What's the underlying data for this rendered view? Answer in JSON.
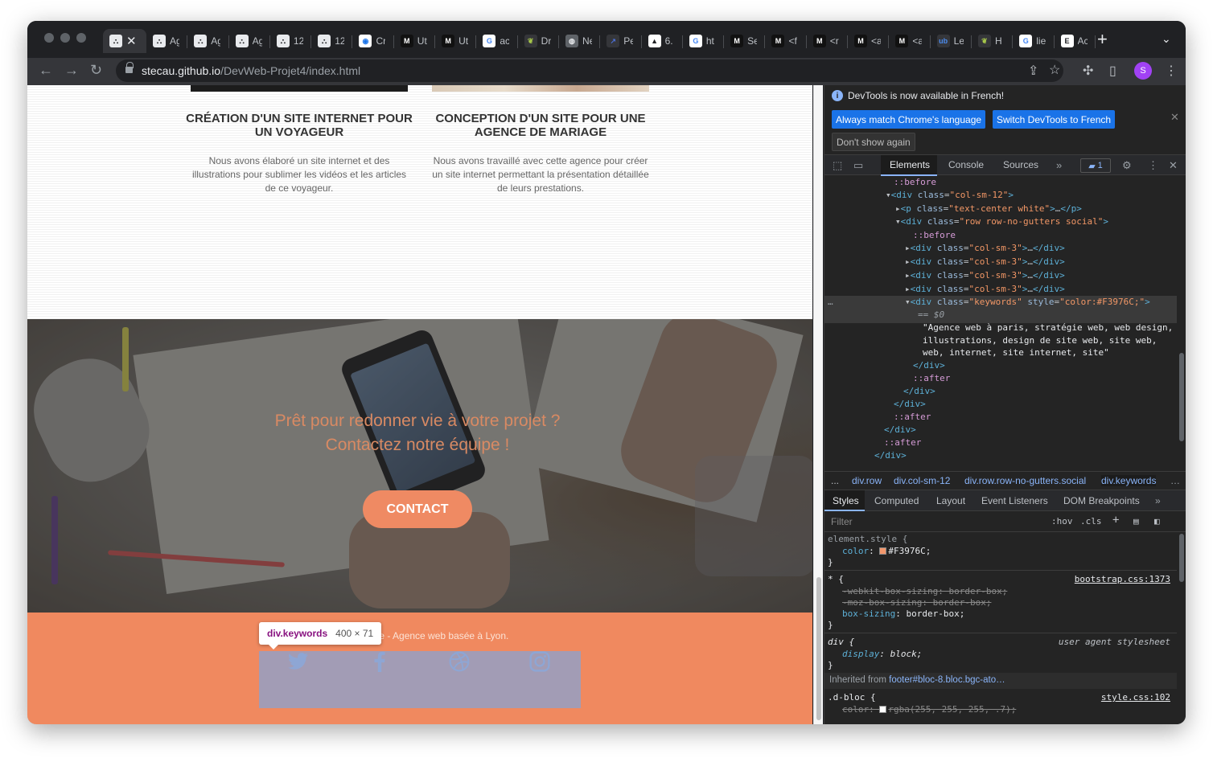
{
  "browser": {
    "tabs": [
      {
        "label": "Ag",
        "fav": "cat",
        "active": true
      },
      {
        "label": "Ag",
        "fav": "cat"
      },
      {
        "label": "Ag",
        "fav": "cat"
      },
      {
        "label": "Ag",
        "fav": "cat"
      },
      {
        "label": "12",
        "fav": "cat"
      },
      {
        "label": "12",
        "fav": "cat"
      },
      {
        "label": "Cr",
        "fav": "chrome"
      },
      {
        "label": "Ut",
        "fav": "m"
      },
      {
        "label": "Ut",
        "fav": "m"
      },
      {
        "label": "ac",
        "fav": "google"
      },
      {
        "label": "Dr",
        "fav": "leaf"
      },
      {
        "label": "Ne",
        "fav": "globe"
      },
      {
        "label": "Pe",
        "fav": "arrow"
      },
      {
        "label": "6.",
        "fav": "peak"
      },
      {
        "label": "ht",
        "fav": "google"
      },
      {
        "label": "Se",
        "fav": "m"
      },
      {
        "label": "<f",
        "fav": "m"
      },
      {
        "label": "<r",
        "fav": "m"
      },
      {
        "label": "<a",
        "fav": "m"
      },
      {
        "label": "<a",
        "fav": "m"
      },
      {
        "label": "Le",
        "fav": "ub"
      },
      {
        "label": "H",
        "fav": "leaf"
      },
      {
        "label": "lie",
        "fav": "google"
      },
      {
        "label": "Ac",
        "fav": "e"
      }
    ],
    "url_domain": "stecau.github.io",
    "url_path": "/DevWeb-Projet4/index.html",
    "profile_initial": "S"
  },
  "page": {
    "projects": [
      {
        "title": "CRÉATION D'UN SITE INTERNET POUR UN VOYAGEUR",
        "desc": "Nous avons élaboré un site internet et des illustrations pour sublimer les vidéos et les articles de ce voyageur."
      },
      {
        "title": "CONCEPTION D'UN SITE POUR UNE AGENCE DE MARIAGE",
        "desc": "Nous avons travaillé avec cette agence pour créer un site internet permettant la présentation détaillée de leurs prestations."
      }
    ],
    "cta_line1": "Prêt pour redonner vie à votre projet ?",
    "cta_line2": "Contactez notre équipe !",
    "contact_button": "CONTACT",
    "footer_text": "here - Agence web basée à Lyon.",
    "tooltip_name": "div.keywords",
    "tooltip_size": "400 × 71",
    "social_icons": [
      "twitter-icon",
      "facebook-icon",
      "dribbble-icon",
      "instagram-icon"
    ],
    "colors": {
      "accent": "#F3976C",
      "footer": "#f0895f"
    }
  },
  "devtools": {
    "info_text": "DevTools is now available in French!",
    "btn_match": "Always match Chrome's language",
    "btn_switch": "Switch DevTools to French",
    "btn_dont_show": "Don't show again",
    "tabs": [
      "Elements",
      "Console",
      "Sources"
    ],
    "issues_count": "1",
    "dom": {
      "before1": "::before",
      "div_col": "div",
      "div_col_class": "col-sm-12",
      "p_class": "text-center white",
      "div_row_class": "row row-no-gutters social",
      "before2": "::before",
      "col3": "col-sm-3",
      "ellipsis": "…",
      "kw_class": "keywords",
      "kw_style": "color:#F3976C;",
      "eq": "== $0",
      "kw_text_1": "\"Agence web à paris, stratégie web, web design,",
      "kw_text_2": "illustrations, design de site web, site web,",
      "kw_text_3": "web, internet, site internet, site\"",
      "after": "::after"
    },
    "crumbs": [
      "...",
      "div.row",
      "div.col-sm-12",
      "div.row.row-no-gutters.social",
      "div.keywords"
    ],
    "style_tabs": [
      "Styles",
      "Computed",
      "Layout",
      "Event Listeners",
      "DOM Breakpoints"
    ],
    "filter_placeholder": "Filter",
    "hov": ":hov",
    "cls": ".cls",
    "rules": {
      "element_style": "element.style",
      "color_prop": "color",
      "color_val": "#F3976C",
      "star": "*",
      "bootstrap_src": "bootstrap.css:1373",
      "webkit_bs": "-webkit-box-sizing",
      "moz_bs": "-moz-box-sizing",
      "bs": "box-sizing",
      "bs_val": "border-box",
      "div_sel": "div",
      "ua_src": "user agent stylesheet",
      "display": "display",
      "block": "block",
      "inherited_from": "Inherited from",
      "inherited_link": "footer#bloc-8.bloc.bgc-ato…",
      "dbloc": ".d-bloc",
      "style_src": "style.css:102",
      "dbloc_color_val": "rgba(255, 255, 255, .7)"
    }
  }
}
